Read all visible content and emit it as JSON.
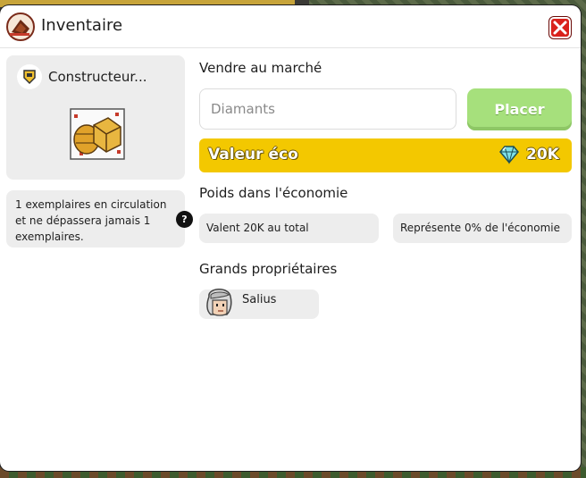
{
  "window": {
    "title": "Inventaire",
    "close_icon": "close-icon"
  },
  "item": {
    "name": "Constructeur...",
    "category_icon": "badge-icon",
    "image_icon": "furniture-crates-icon",
    "circulation_text": "1 exemplaires en circulation et ne dépassera jamais 1 exemplaires.",
    "help_label": "?"
  },
  "market": {
    "title": "Vendre au marché",
    "price_placeholder": "Diamants",
    "price_value": "",
    "place_button": "Placer",
    "eco_label": "Valeur éco",
    "eco_value": "20K",
    "currency_icon": "diamond-icon"
  },
  "economy": {
    "title": "Poids dans l'économie",
    "total_text": "Valent 20K au total",
    "share_text": "Représente 0% de l'économie"
  },
  "owners": {
    "title": "Grands propriétaires",
    "items": [
      {
        "name": "Salius",
        "avatar": "avatar-icon"
      }
    ]
  },
  "colors": {
    "accent_yellow": "#f3c800",
    "button_green": "#a6e07c",
    "close_red": "#d9221c",
    "panel_gray": "#ededed"
  }
}
